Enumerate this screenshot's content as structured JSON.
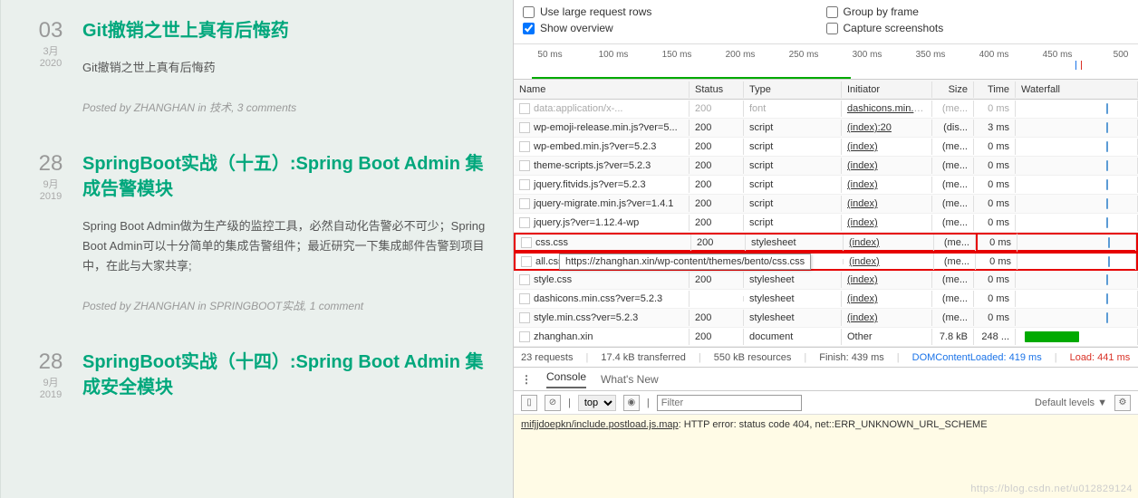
{
  "posts": [
    {
      "day": "03",
      "month": "3月",
      "year": "2020",
      "title": "Git撤销之世上真有后悔药",
      "desc": "Git撤销之世上真有后悔药",
      "author": "ZHANGHAN",
      "cat": "技术",
      "comments": "3 comments"
    },
    {
      "day": "28",
      "month": "9月",
      "year": "2019",
      "title": "SpringBoot实战（十五）:Spring Boot Admin 集成告警模块",
      "desc": " Spring Boot Admin做为生产级的监控工具，必然自动化告警必不可少；Spring Boot Admin可以十分简单的集成告警组件；最近研究一下集成邮件告警到项目中，在此与大家共享;",
      "author": "ZHANGHAN",
      "cat": "SPRINGBOOT实战",
      "comments": "1 comment"
    },
    {
      "day": "28",
      "month": "9月",
      "year": "2019",
      "title": "SpringBoot实战（十四）:Spring Boot Admin 集成安全模块",
      "desc": "",
      "author": "",
      "cat": "",
      "comments": ""
    }
  ],
  "options": {
    "large": "Use large request rows",
    "overview": "Show overview",
    "group": "Group by frame",
    "capture": "Capture screenshots"
  },
  "timeline": {
    "ticks": [
      "50 ms",
      "100 ms",
      "150 ms",
      "200 ms",
      "250 ms",
      "300 ms",
      "350 ms",
      "400 ms",
      "450 ms",
      "500"
    ]
  },
  "headers": {
    "name": "Name",
    "status": "Status",
    "type": "Type",
    "initiator": "Initiator",
    "size": "Size",
    "time": "Time",
    "waterfall": "Waterfall"
  },
  "tooltip": "https://zhanghan.xin/wp-content/themes/bento/css.css",
  "rows": [
    {
      "name": "data:application/x-...",
      "status": "200",
      "type": "font",
      "initiator": "dashicons.min.c...",
      "size": "(me...",
      "time": "0 ms",
      "dis": true
    },
    {
      "name": "wp-emoji-release.min.js?ver=5...",
      "status": "200",
      "type": "script",
      "initiator": "(index):20",
      "size": "(dis...",
      "time": "3 ms"
    },
    {
      "name": "wp-embed.min.js?ver=5.2.3",
      "status": "200",
      "type": "script",
      "initiator": "(index)",
      "size": "(me...",
      "time": "0 ms"
    },
    {
      "name": "theme-scripts.js?ver=5.2.3",
      "status": "200",
      "type": "script",
      "initiator": "(index)",
      "size": "(me...",
      "time": "0 ms"
    },
    {
      "name": "jquery.fitvids.js?ver=5.2.3",
      "status": "200",
      "type": "script",
      "initiator": "(index)",
      "size": "(me...",
      "time": "0 ms"
    },
    {
      "name": "jquery-migrate.min.js?ver=1.4.1",
      "status": "200",
      "type": "script",
      "initiator": "(index)",
      "size": "(me...",
      "time": "0 ms"
    },
    {
      "name": "jquery.js?ver=1.12.4-wp",
      "status": "200",
      "type": "script",
      "initiator": "(index)",
      "size": "(me...",
      "time": "0 ms"
    },
    {
      "name": "css.css",
      "status": "200",
      "type": "stylesheet",
      "initiator": "(index)",
      "size": "(me...",
      "time": "0 ms",
      "hl": true,
      "tmbox": true
    },
    {
      "name": "all.css",
      "status": "",
      "type": "",
      "initiator": "(index)",
      "size": "(me...",
      "time": "0 ms",
      "hl": true,
      "tip": true
    },
    {
      "name": "style.css",
      "status": "200",
      "type": "stylesheet",
      "initiator": "(index)",
      "size": "(me...",
      "time": "0 ms"
    },
    {
      "name": "dashicons.min.css?ver=5.2.3",
      "status": "",
      "type": "stylesheet",
      "initiator": "(index)",
      "size": "(me...",
      "time": "0 ms"
    },
    {
      "name": "style.min.css?ver=5.2.3",
      "status": "200",
      "type": "stylesheet",
      "initiator": "(index)",
      "size": "(me...",
      "time": "0 ms"
    },
    {
      "name": "zhanghan.xin",
      "status": "200",
      "type": "document",
      "initiator": "Other",
      "size": "7.8 kB",
      "time": "248 ...",
      "wf": true
    }
  ],
  "summary": {
    "req": "23 requests",
    "xfer": "17.4 kB transferred",
    "res": "550 kB resources",
    "fin": "Finish: 439 ms",
    "dcl": "DOMContentLoaded: 419 ms",
    "load": "Load: 441 ms"
  },
  "tabs": {
    "console": "Console",
    "whatsnew": "What's New"
  },
  "console": {
    "top": "top",
    "filter": "Filter",
    "levels": "Default levels ▼",
    "msg_file": "mifjjdoepkn/include.postload.js.map",
    "msg_text": ": HTTP error: status code 404, net::ERR_UNKNOWN_URL_SCHEME"
  },
  "watermark": "https://blog.csdn.net/u012829124",
  "meta_tpl": {
    "posted": "Posted by ",
    "in": " in ",
    "sep": ", "
  }
}
